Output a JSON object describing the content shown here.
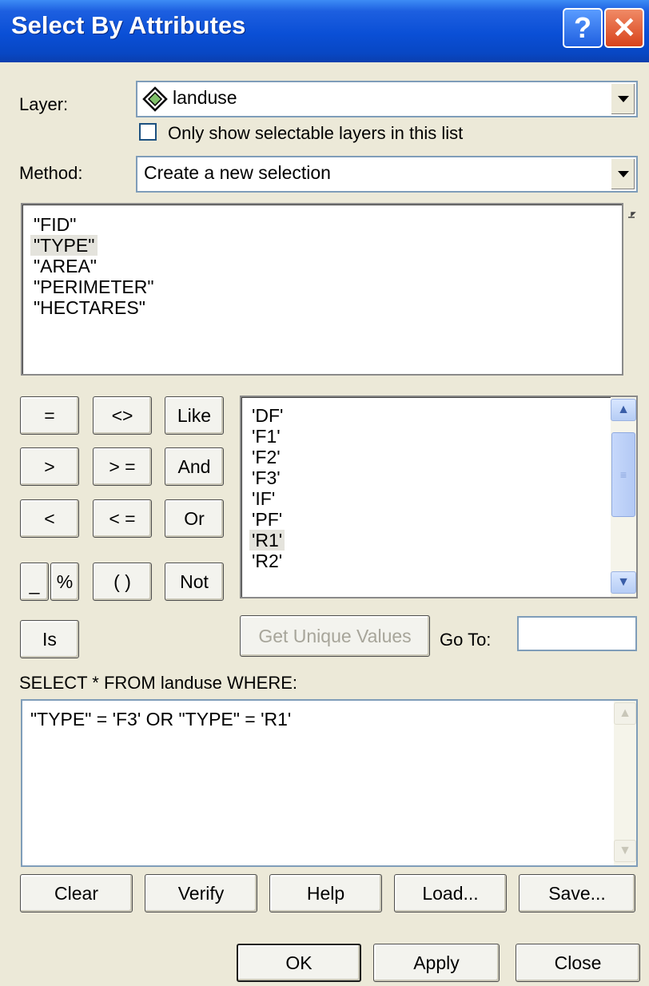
{
  "window": {
    "title": "Select By Attributes",
    "help_glyph": "?",
    "close_glyph": "✕"
  },
  "layer": {
    "label": "Layer:",
    "value": "landuse",
    "icon": "layer-diamond-icon",
    "only_selectable_label": "Only show selectable layers in this list",
    "only_selectable_checked": false
  },
  "method": {
    "label": "Method:",
    "value": "Create a new selection"
  },
  "fields": [
    "\"FID\"",
    "\"TYPE\"",
    "\"AREA\"",
    "\"PERIMETER\"",
    "\"HECTARES\""
  ],
  "selected_field": "\"TYPE\"",
  "operators": {
    "eq": "=",
    "ne": "<>",
    "like": "Like",
    "gt": ">",
    "ge": "> =",
    "and": "And",
    "lt": "<",
    "le": "< =",
    "or": "Or",
    "underscore": "_",
    "percent": "%",
    "parens": "( )",
    "not": "Not",
    "is": "Is"
  },
  "values": [
    "'DF'",
    "'F1'",
    "'F2'",
    "'F3'",
    "'IF'",
    "'PF'",
    "'R1'",
    "'R2'"
  ],
  "selected_value": "'R1'",
  "get_unique_values_label": "Get Unique Values",
  "goto": {
    "label": "Go To:",
    "value": ""
  },
  "query": {
    "prefix": "SELECT * FROM landuse WHERE:",
    "expression": "\"TYPE\" = 'F3' OR \"TYPE\" = 'R1'"
  },
  "actions": {
    "clear": "Clear",
    "verify": "Verify",
    "help": "Help",
    "load": "Load...",
    "save": "Save..."
  },
  "footer": {
    "ok": "OK",
    "apply": "Apply",
    "close": "Close"
  },
  "colors": {
    "titlebar": "#0a4fd6",
    "dialog_bg": "#ece9d8",
    "selection": "#e4e3dc",
    "scrollbar": "#b3c9f4"
  }
}
